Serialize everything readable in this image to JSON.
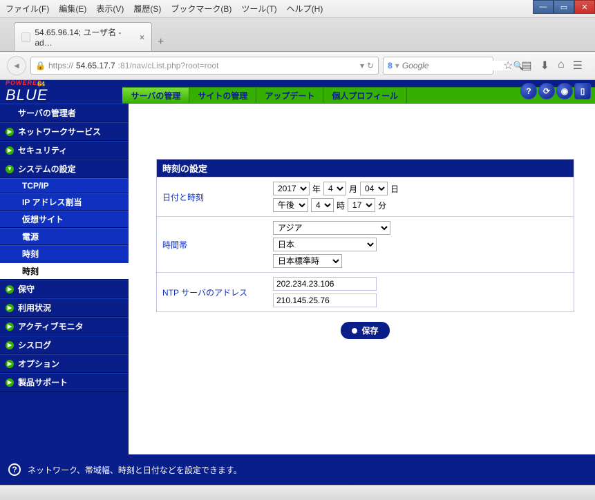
{
  "browser": {
    "menu": [
      "ファイル(F)",
      "編集(E)",
      "表示(V)",
      "履歴(S)",
      "ブックマーク(B)",
      "ツール(T)",
      "ヘルプ(H)"
    ],
    "tab_title": "54.65.96.14; ユーザ名 - ad…",
    "url_prefix": "https://",
    "url_host": "54.65.17.7",
    "url_rest": ":81/nav/cList.php?root=root",
    "search_placeholder": "Google"
  },
  "logo": {
    "powered": "POWERED",
    "blue": "BLUE",
    "sixtyfour": "64"
  },
  "tabs": [
    "サーバの管理",
    "サイトの管理",
    "アップデート",
    "個人プロフィール"
  ],
  "sidebar": {
    "items": [
      {
        "label": "サーバの管理者",
        "type": "top"
      },
      {
        "label": "ネットワークサービス",
        "type": "top"
      },
      {
        "label": "セキュリティ",
        "type": "top"
      },
      {
        "label": "システムの設定",
        "type": "top"
      },
      {
        "label": "TCP/IP",
        "type": "sub"
      },
      {
        "label": "IP アドレス割当",
        "type": "sub"
      },
      {
        "label": "仮想サイト",
        "type": "sub"
      },
      {
        "label": "電源",
        "type": "sub"
      },
      {
        "label": "時刻",
        "type": "sub"
      },
      {
        "label": "時刻",
        "type": "sub-active"
      },
      {
        "label": "保守",
        "type": "top"
      },
      {
        "label": "利用状況",
        "type": "top"
      },
      {
        "label": "アクティブモニタ",
        "type": "top"
      },
      {
        "label": "シスログ",
        "type": "top"
      },
      {
        "label": "オプション",
        "type": "top"
      },
      {
        "label": "製品サポート",
        "type": "top"
      }
    ]
  },
  "panel": {
    "title": "時刻の設定",
    "rows": {
      "datetime": {
        "label": "日付と時刻",
        "year": "2017",
        "year_suffix": "年",
        "month": "4",
        "month_suffix": "月",
        "day": "04",
        "day_suffix": "日",
        "ampm": "午後",
        "hour": "4",
        "hour_suffix": "時",
        "minute": "17",
        "minute_suffix": "分"
      },
      "timezone": {
        "label": "時間帯",
        "region": "アジア",
        "country": "日本",
        "tz": "日本標準時"
      },
      "ntp": {
        "label": "NTP サーバのアドレス",
        "servers": [
          "202.234.23.106",
          "210.145.25.76"
        ]
      }
    },
    "save_label": "保存"
  },
  "status": "ネットワーク、帯域幅、時刻と日付などを設定できます。"
}
